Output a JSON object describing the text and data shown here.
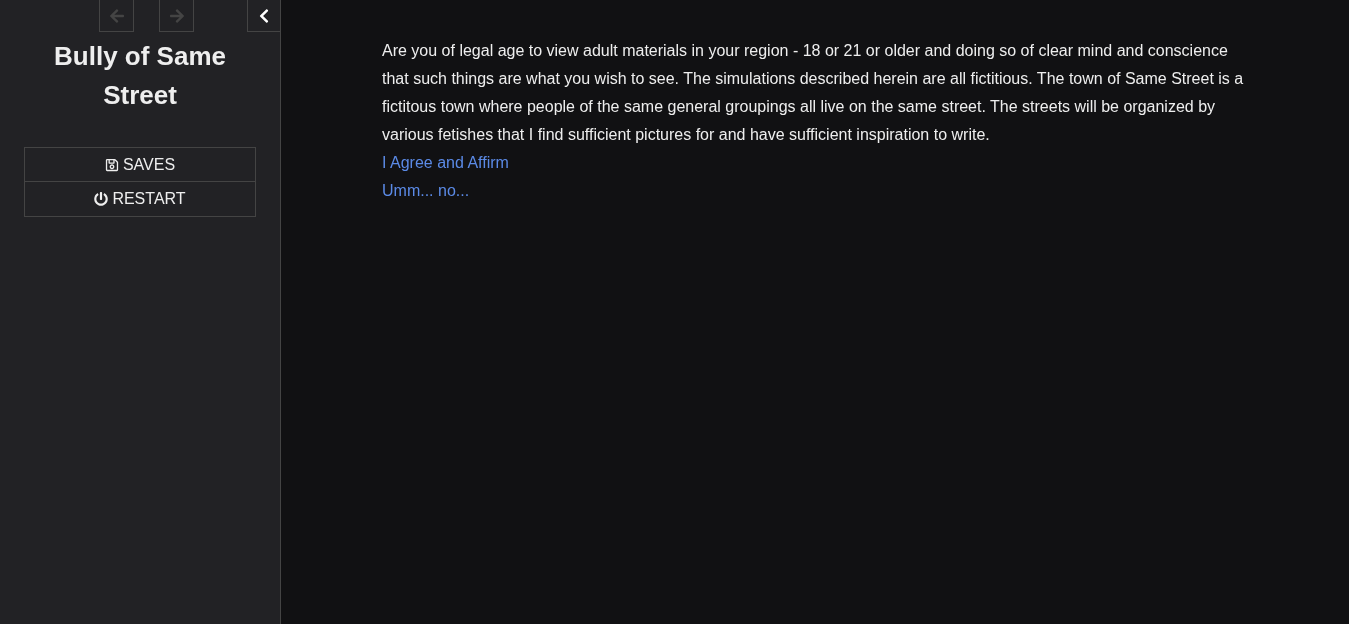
{
  "sidebar": {
    "history": [
      {
        "kind": "back",
        "disabled": true
      },
      {
        "kind": "forward",
        "disabled": true
      }
    ],
    "title": "Bully of Same Street",
    "menu": [
      {
        "kind": "saves",
        "label": "SAVES"
      },
      {
        "kind": "restart",
        "label": "RESTART"
      }
    ]
  },
  "passage": {
    "text": "Are you of legal age to view adult materials in your region - 18 or 21 or older and doing so of clear mind and conscience that such things are what you wish to see. The simulations described herein are all fictitious. The town of Same Street is a fictitous town where people of the same general groupings all live on the same street. The streets will be organized by various fetishes that I find sufficient pictures for and have sufficient inspiration to write.",
    "links": [
      {
        "label": "I Agree and Affirm"
      },
      {
        "label": "Umm... no..."
      }
    ]
  }
}
